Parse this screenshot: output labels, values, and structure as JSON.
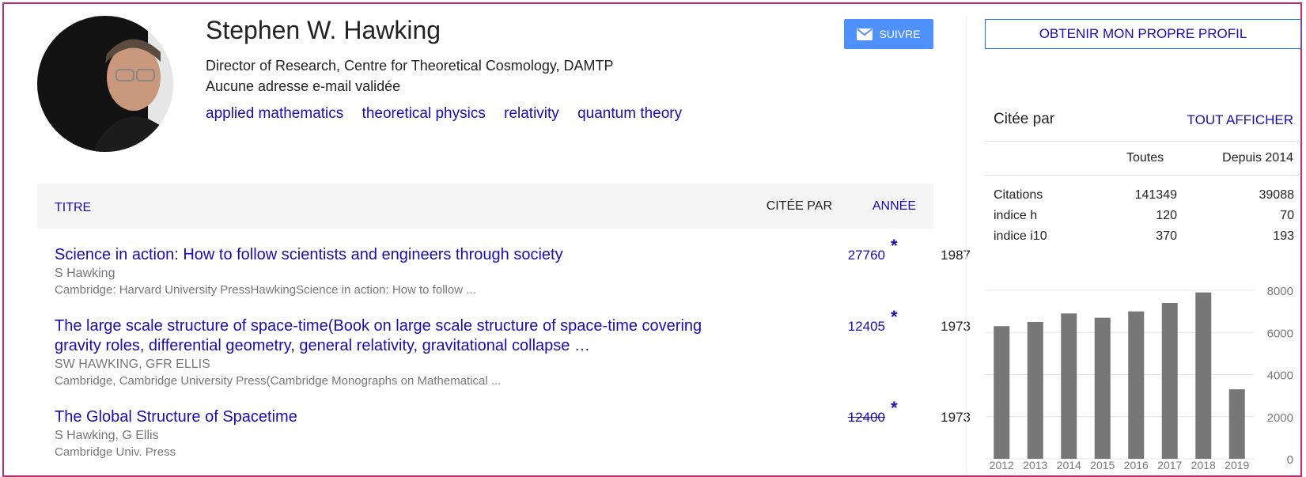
{
  "profile": {
    "name": "Stephen W. Hawking",
    "affiliation": "Director of Research, Centre for Theoretical Cosmology, DAMTP",
    "email_status": "Aucune adresse e-mail validée",
    "interests": [
      "applied mathematics",
      "theoretical physics",
      "relativity",
      "quantum theory"
    ],
    "follow_label": "SUIVRE"
  },
  "table": {
    "col_title": "TITRE",
    "col_cited": "CITÉE PAR",
    "col_year": "ANNÉE",
    "rows": [
      {
        "title": "Science in action: How to follow scientists and engineers through society",
        "authors": "S Hawking",
        "venue": "Cambridge: Harvard University PressHawkingScience in action: How to follow ...",
        "cites": "27760",
        "star": "*",
        "year": "1987"
      },
      {
        "title": "The large scale structure of space-time(Book on large scale structure of space-time covering gravity roles, differential geometry, general relativity, gravitational collapse …",
        "authors": "SW HAWKING, GFR ELLIS",
        "venue": "Cambridge, Cambridge University Press(Cambridge Monographs on Mathematical ...",
        "cites": "12405",
        "star": "*",
        "year": "1973"
      },
      {
        "title": "The Global Structure of Spacetime",
        "authors": "S Hawking, G Ellis",
        "venue": "Cambridge Univ. Press",
        "cites": "12400",
        "star": "*",
        "year": "1973"
      }
    ]
  },
  "sidebar": {
    "profile_button": "OBTENIR MON PROPRE PROFIL",
    "cited_by": "Citée par",
    "show_all": "TOUT AFFICHER",
    "col_all": "Toutes",
    "col_since": "Depuis 2014",
    "stats": [
      {
        "label": "Citations",
        "all": "141349",
        "since": "39088"
      },
      {
        "label": "indice h",
        "all": "120",
        "since": "70"
      },
      {
        "label": "indice i10",
        "all": "370",
        "since": "193"
      }
    ]
  },
  "chart_data": {
    "type": "bar",
    "categories": [
      "2012",
      "2013",
      "2014",
      "2015",
      "2016",
      "2017",
      "2018",
      "2019"
    ],
    "values": [
      6300,
      6500,
      6900,
      6700,
      7000,
      7400,
      7900,
      3300
    ],
    "ylim": [
      0,
      8000
    ],
    "yticks": [
      "8000",
      "6000",
      "4000",
      "2000",
      "0"
    ],
    "bar_color": "#777777"
  }
}
